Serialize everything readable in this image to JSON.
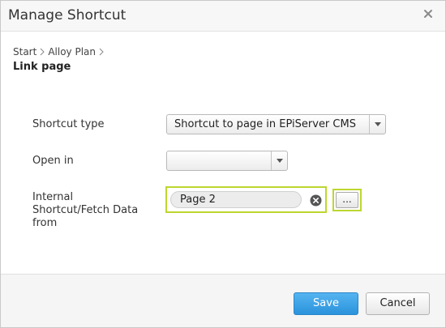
{
  "dialog": {
    "title": "Manage Shortcut",
    "close_icon": "close-icon"
  },
  "breadcrumb": {
    "items": [
      "Start",
      "Alloy Plan"
    ],
    "separator_icon": "chevron-right-icon"
  },
  "page_name": "Link page",
  "form": {
    "shortcut_type": {
      "label": "Shortcut type",
      "value": "Shortcut to page in EPiServer CMS",
      "icon": "chevron-down-icon"
    },
    "open_in": {
      "label": "Open in",
      "value": "",
      "icon": "chevron-down-icon"
    },
    "internal_shortcut": {
      "label_lines": [
        "Internal",
        "Shortcut/Fetch Data",
        "from"
      ],
      "value": "Page 2",
      "clear_icon": "clear-icon",
      "browse_label": "..."
    }
  },
  "footer": {
    "save_label": "Save",
    "cancel_label": "Cancel"
  },
  "colors": {
    "accent_border": "#bed62f",
    "primary_button": "#2a93dc",
    "titlebar_bg": "#f7f7f7"
  }
}
